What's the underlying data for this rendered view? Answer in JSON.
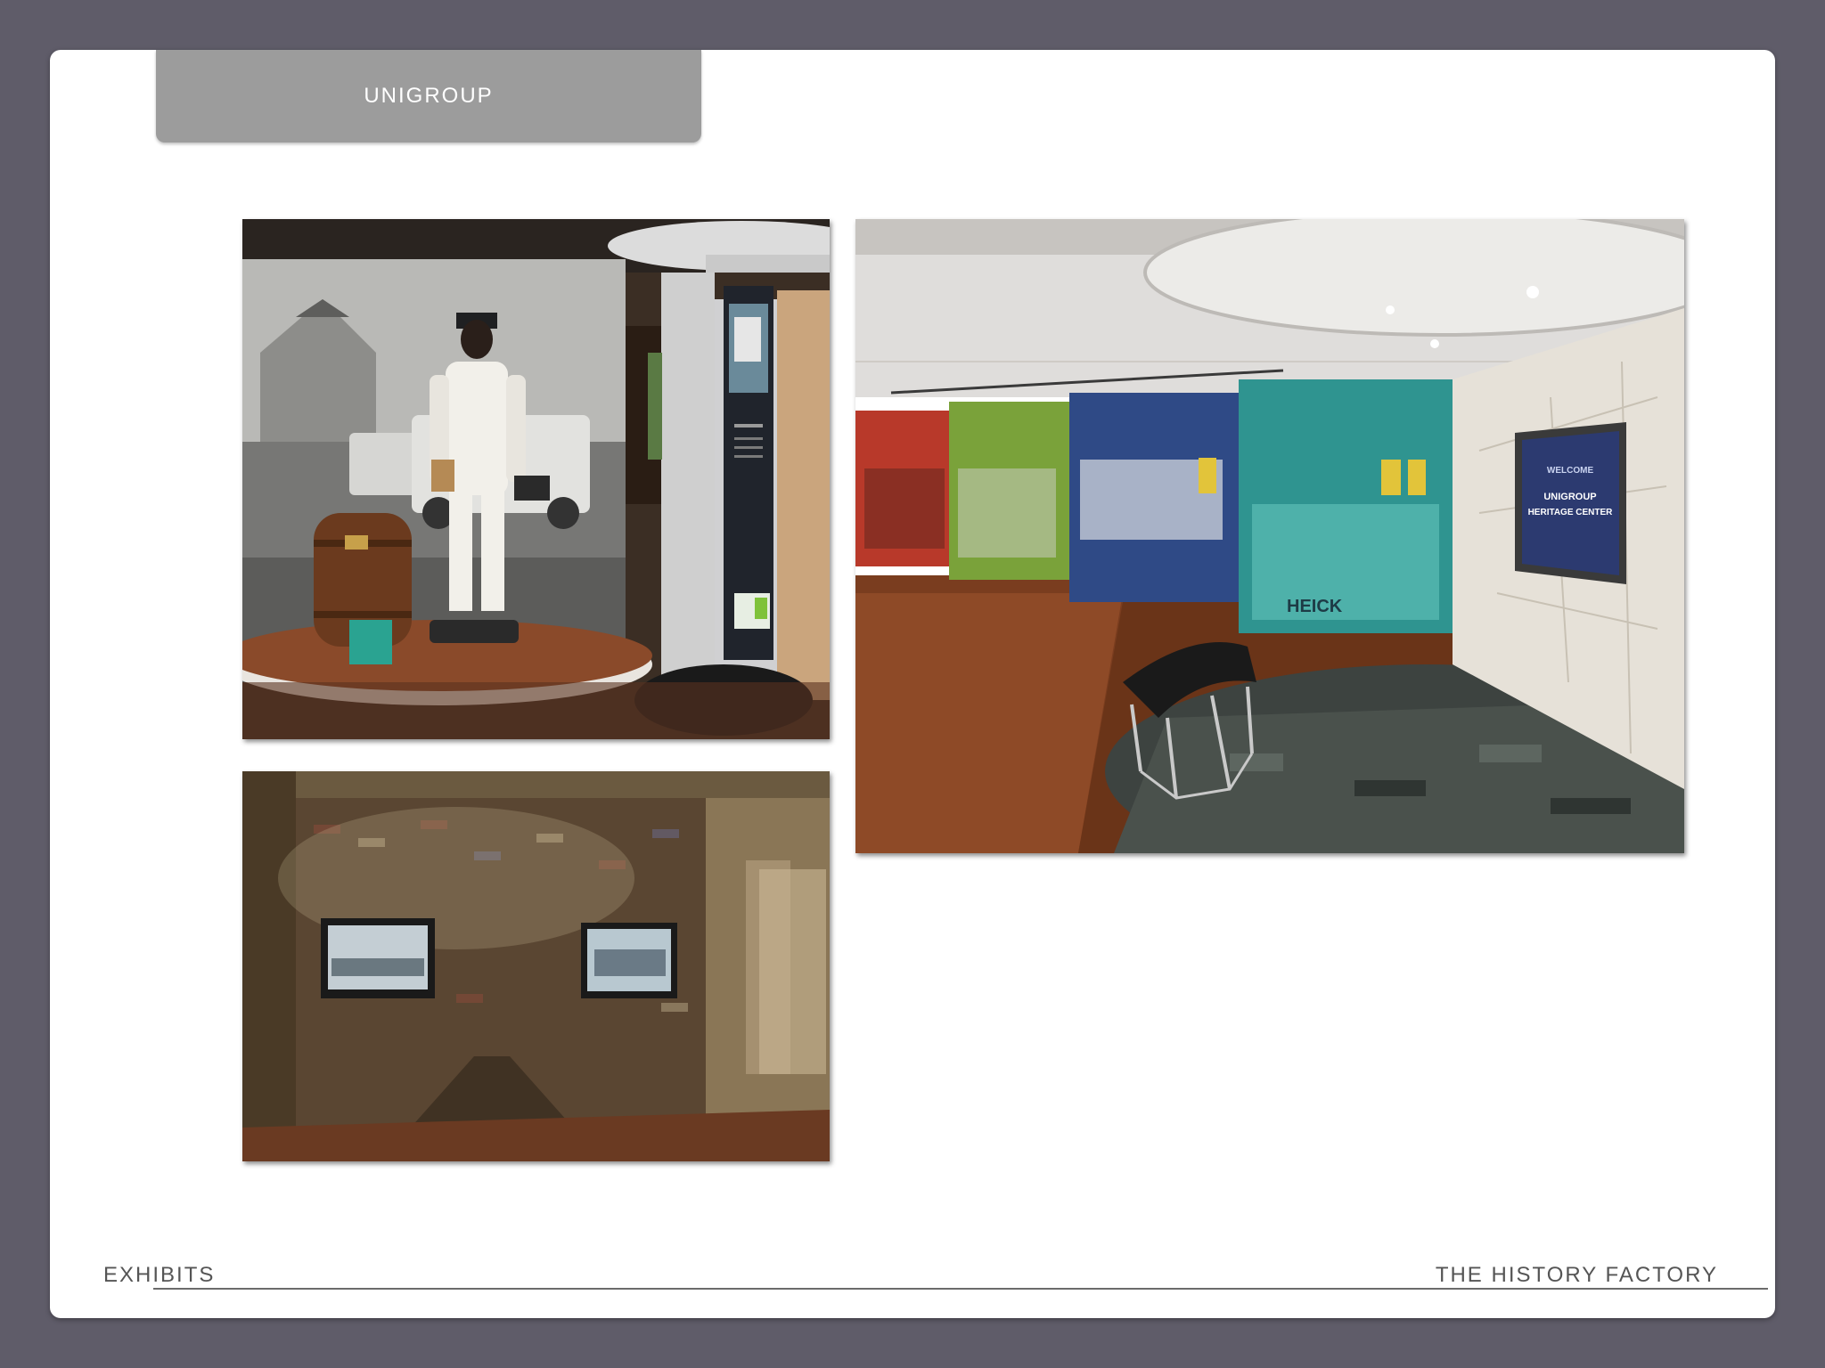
{
  "header": {
    "tab_label": "UNIGROUP"
  },
  "footer": {
    "section": "EXHIBITS",
    "brand": "THE HISTORY FACTORY"
  },
  "photos": {
    "hall": {
      "screen_line1": "WELCOME",
      "screen_line2": "UNIGROUP",
      "screen_line3": "HERITAGE CENTER",
      "truck_sign": "HEICK"
    }
  },
  "colors": {
    "frame": "#5f5c69",
    "tab": "#9c9c9c",
    "panel_red": "#b8392a",
    "panel_green": "#7aa23a",
    "panel_blue": "#2f4a86",
    "panel_teal": "#2f9490"
  }
}
